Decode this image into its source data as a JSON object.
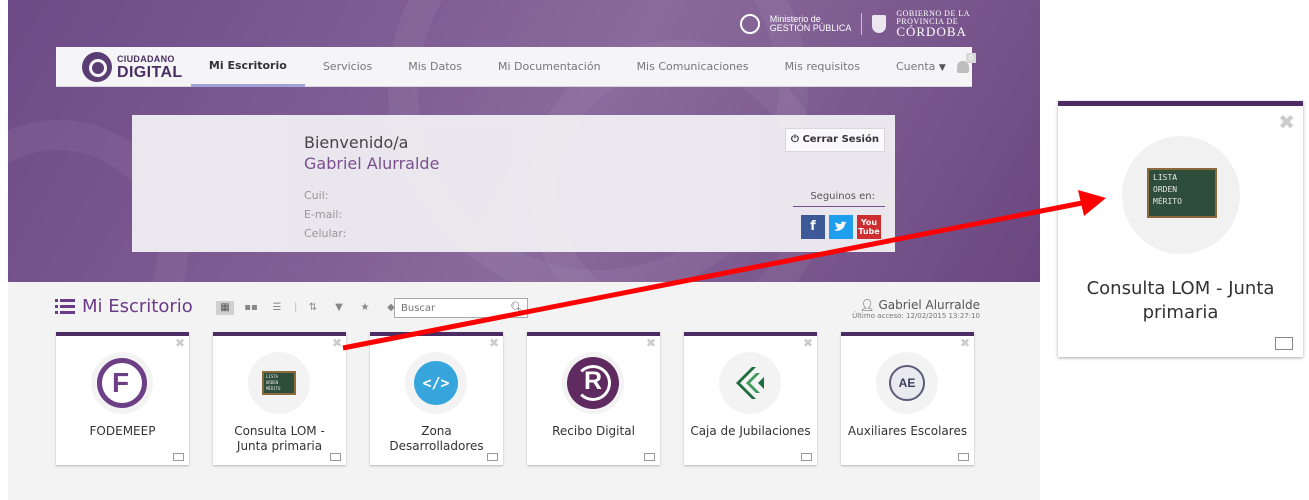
{
  "gov_logos": {
    "ministry_line1": "Ministerio de",
    "ministry_line2": "GESTIÓN PÚBLICA",
    "gov_line1": "GOBIERNO DE LA",
    "gov_line2": "PROVINCIA DE",
    "gov_line3": "CÓRDOBA"
  },
  "brand": {
    "line1": "CIUDADANO",
    "line2": "DIGITAL"
  },
  "nav": {
    "items": [
      "Mi Escritorio",
      "Servicios",
      "Mis Datos",
      "Mi Documentación",
      "Mis Comunicaciones",
      "Mis requisitos"
    ],
    "account_label": "Cuenta",
    "notification_count": "0"
  },
  "welcome": {
    "greeting": "Bienvenido/a",
    "user_name": "Gabriel Alurralde",
    "cuil_label": "Cuil:",
    "email_label": "E-mail:",
    "phone_label": "Celular:",
    "logout_label": "⏻ Cerrar Sesión",
    "social_label": "Seguinos en:"
  },
  "desk": {
    "title": "Mi Escritorio",
    "search_placeholder": "Buscar",
    "user_name": "Gabriel Alurralde",
    "last_access": "Último acceso: 12/02/2015 13:27:10"
  },
  "tiles": [
    {
      "label": "FODEMEEP"
    },
    {
      "label": "Consulta LOM - Junta primaria"
    },
    {
      "label": "Zona Desarrolladores"
    },
    {
      "label": "Recibo Digital"
    },
    {
      "label": "Caja de Jubilaciones"
    },
    {
      "label": "Auxiliares Escolares"
    }
  ],
  "board_text": [
    "LISTA",
    "ORDEN",
    "MÉRITO"
  ],
  "zoom": {
    "label": "Consulta LOM - Junta primaria"
  },
  "colors": {
    "accent": "#4d2b63",
    "hero": "#7d5a92",
    "arrow": "#ff0000",
    "title": "#6a3b87"
  }
}
